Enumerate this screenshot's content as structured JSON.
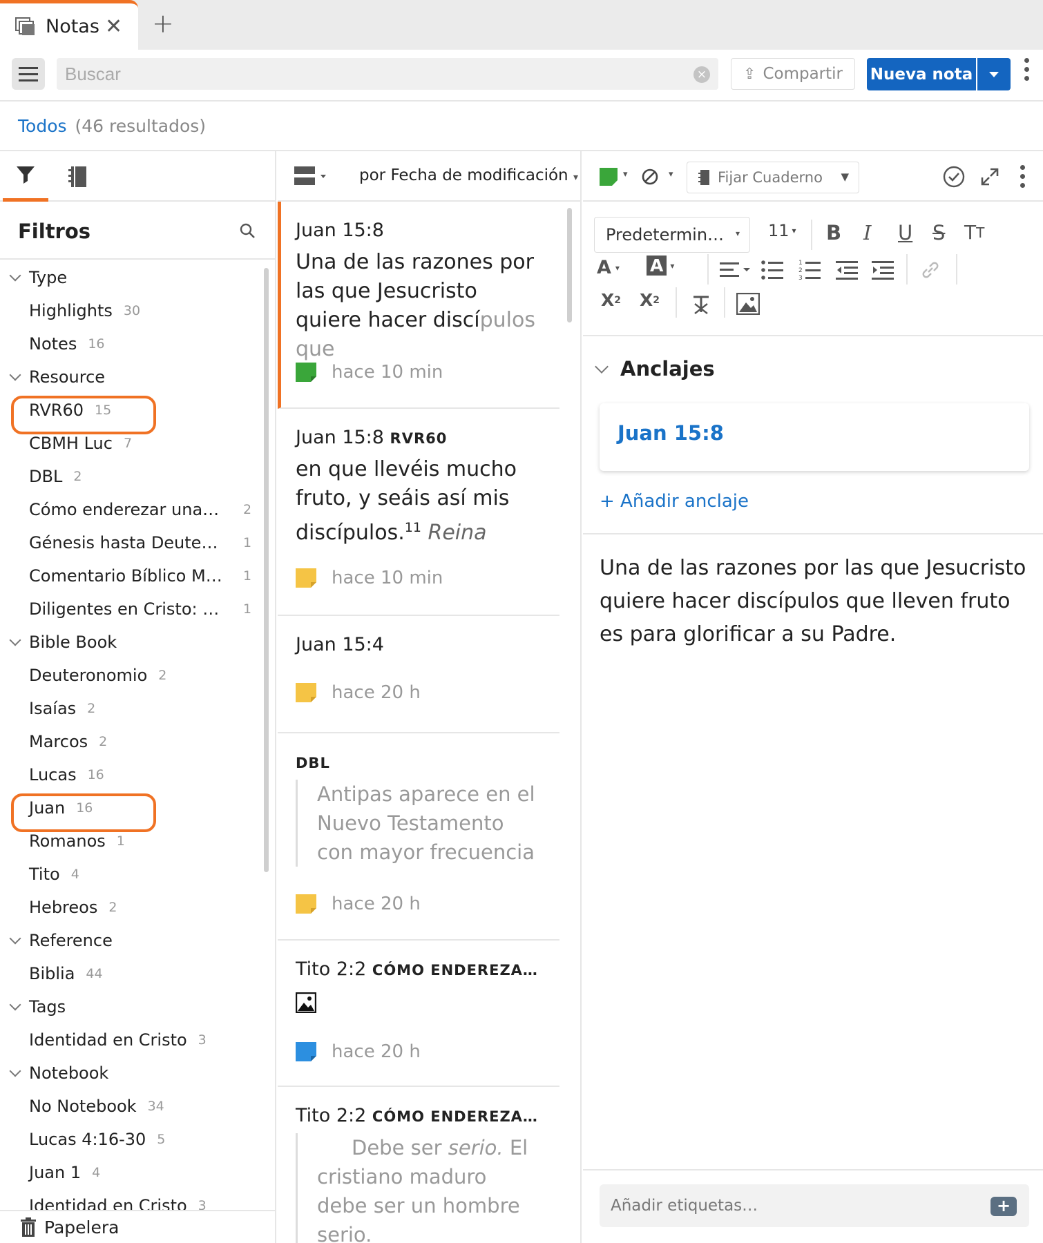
{
  "tab": {
    "label": "Notas"
  },
  "toolbar": {
    "search_placeholder": "Buscar",
    "share_label": "Compartir",
    "new_note_label": "Nueva nota"
  },
  "breadcrumb": {
    "link": "Todos",
    "count": "(46 resultados)"
  },
  "filters": {
    "title": "Filtros",
    "groups": [
      {
        "label": "Type",
        "items": [
          {
            "label": "Highlights",
            "count": "30"
          },
          {
            "label": "Notes",
            "count": "16"
          }
        ]
      },
      {
        "label": "Resource",
        "items": [
          {
            "label": "RVR60",
            "count": "15"
          },
          {
            "label": "CBMH Luc",
            "count": "7"
          },
          {
            "label": "DBL",
            "count": "2"
          },
          {
            "label": "Cómo enderezar una ig…",
            "count": "2"
          },
          {
            "label": "Génesis hasta Deutero…",
            "count": "1"
          },
          {
            "label": "Comentario Bíblico Mu…",
            "count": "1"
          },
          {
            "label": "Diligentes en Cristo: Est…",
            "count": "1"
          }
        ]
      },
      {
        "label": "Bible Book",
        "items": [
          {
            "label": "Deuteronomio",
            "count": "2"
          },
          {
            "label": "Isaías",
            "count": "2"
          },
          {
            "label": "Marcos",
            "count": "2"
          },
          {
            "label": "Lucas",
            "count": "16"
          },
          {
            "label": "Juan",
            "count": "16"
          },
          {
            "label": "Romanos",
            "count": "1"
          },
          {
            "label": "Tito",
            "count": "4"
          },
          {
            "label": "Hebreos",
            "count": "2"
          }
        ]
      },
      {
        "label": "Reference",
        "items": [
          {
            "label": "Biblia",
            "count": "44"
          }
        ]
      },
      {
        "label": "Tags",
        "items": [
          {
            "label": "Identidad en Cristo",
            "count": "3"
          }
        ]
      },
      {
        "label": "Notebook",
        "items": [
          {
            "label": "No Notebook",
            "count": "34"
          },
          {
            "label": "Lucas 4:16-30",
            "count": "5"
          },
          {
            "label": "Juan 1",
            "count": "4"
          },
          {
            "label": "Identidad en Cristo",
            "count": "3"
          }
        ]
      }
    ],
    "trash_label": "Papelera"
  },
  "list": {
    "sort_label": "por Fecha de modificación",
    "cards": [
      {
        "title": "Juan 15:8",
        "text": "Una de las razones por las que Jesucristo quiere hacer discí",
        "text_fade": "pulos que",
        "time": "hace 10 min"
      },
      {
        "title": "Juan 15:8",
        "title_small": "RVR60",
        "text": "en que llevéis mucho fruto, y seáis así mis discípulos.",
        "sup": "11",
        "italic": "Reina",
        "time": "hace 10 min"
      },
      {
        "title": "Juan 15:4",
        "time": "hace 20 h"
      },
      {
        "title_small": "DBL",
        "quote": "Antipas aparece en el Nuevo Testamento con mayor frecuencia que",
        "time": "hace 20 h"
      },
      {
        "title": "Tito 2:2",
        "title_small": "CÓMO ENDEREZA…",
        "time": "hace 20 h"
      },
      {
        "title": "Tito 2:2",
        "title_small": "CÓMO ENDEREZA…",
        "quote_a": "Debe ser ",
        "quote_i": "serio.",
        "quote_b": " El cristiano maduro debe ser un hombre serio."
      }
    ]
  },
  "editor": {
    "notebook_placeholder": "Fijar Cuaderno",
    "font_family": "Predetermin…",
    "font_size": "11",
    "anchors_title": "Anclajes",
    "anchor": "Juan 15:8",
    "add_anchor": "+ Añadir anclaje",
    "body": "Una de las razones por las que Jesucristo quiere hacer discípulos que lleven fruto es para glorificar a su Padre.",
    "tags_placeholder": "Añadir etiquetas…"
  },
  "colors": {
    "accent": "#f07224",
    "primary": "#1465c0",
    "link": "#1a73c8",
    "note_green": "#3aa63a",
    "note_yellow": "#f5c445",
    "note_blue": "#2c8fe0"
  }
}
